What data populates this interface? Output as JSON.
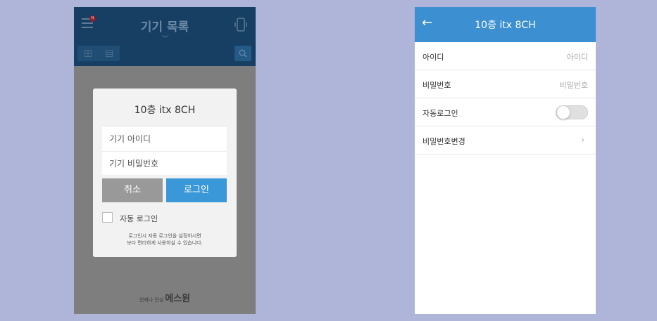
{
  "left_screen": {
    "header": {
      "title": "기기 목록",
      "badge": "N",
      "caret": "﹀"
    },
    "dialog": {
      "title": "10층 itx 8CH",
      "id_placeholder": "기기 아이디",
      "password_placeholder": "기기 비밀번호",
      "cancel_label": "취소",
      "login_label": "로그인",
      "auto_login_label": "자동 로그인",
      "note_line1": "로그인시 자동 로그인을 설정하시면",
      "note_line2": "보다 편리하게 사용하실 수 있습니다."
    },
    "footer": {
      "tagline": "언제나 안심",
      "brand": "에스원"
    }
  },
  "right_screen": {
    "header": {
      "back": "←",
      "title": "10층 itx 8CH"
    },
    "rows": [
      {
        "label": "아이디",
        "value": "아이디"
      },
      {
        "label": "비밀번호",
        "value": "비밀번호"
      },
      {
        "label": "자동로그인",
        "toggle": false
      },
      {
        "label": "비밀번호변경",
        "chevron": "›"
      }
    ]
  },
  "colors": {
    "background": "#aeb5d9",
    "header_dark": "#163f63",
    "header_blue": "#3c8fd1",
    "login_button": "#3a98d8",
    "cancel_button": "#999999"
  }
}
